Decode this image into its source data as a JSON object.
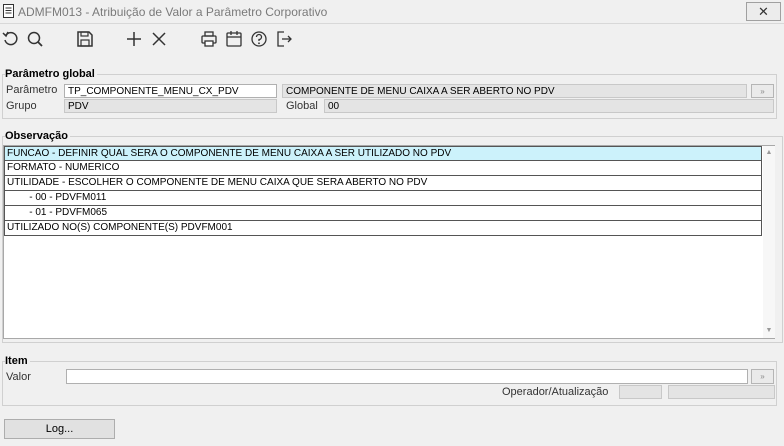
{
  "window": {
    "title": "ADMFM013 - Atribuição de Valor a Parâmetro Corporativo",
    "close_glyph": "✕"
  },
  "toolbar": {
    "buttons": [
      {
        "name": "refresh-button",
        "icon": "refresh-icon"
      },
      {
        "name": "search-button",
        "icon": "search-icon"
      },
      {
        "name": "save-button",
        "icon": "save-icon"
      },
      {
        "name": "add-button",
        "icon": "plus-icon"
      },
      {
        "name": "delete-button",
        "icon": "close-icon"
      },
      {
        "name": "print-button",
        "icon": "printer-icon"
      },
      {
        "name": "calendar-button",
        "icon": "calendar-icon"
      },
      {
        "name": "help-button",
        "icon": "help-icon"
      },
      {
        "name": "exit-button",
        "icon": "exit-icon"
      }
    ]
  },
  "parametro_global": {
    "title": "Parâmetro global",
    "parametro_label": "Parâmetro",
    "parametro_value": "TP_COMPONENTE_MENU_CX_PDV",
    "descricao_value": "COMPONENTE DE MENU CAIXA A SER ABERTO NO PDV",
    "grupo_label": "Grupo",
    "grupo_value": "PDV",
    "global_label": "Global",
    "global_value": "00"
  },
  "observacao": {
    "title": "Observação",
    "lines": [
      "FUNCAO - DEFINIR QUAL SERA O COMPONENTE DE MENU CAIXA A SER UTILIZADO NO PDV",
      "FORMATO - NUMERICO",
      "UTILIDADE - ESCOLHER O COMPONENTE DE MENU CAIXA QUE SERA ABERTO NO PDV",
      "        - 00 - PDVFM011",
      "        - 01 - PDVFM065",
      "UTILIZADO NO(S) COMPONENTE(S) PDVFM001"
    ]
  },
  "item": {
    "title": "Item",
    "valor_label": "Valor",
    "valor_value": "",
    "operador_label": "Operador/Atualização",
    "operador_value": "",
    "atualizacao_value": ""
  },
  "footer": {
    "log_label": "Log..."
  }
}
